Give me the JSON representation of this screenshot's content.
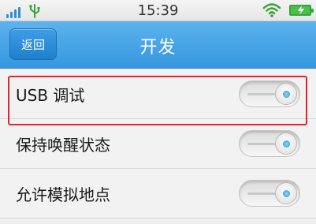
{
  "status_bar": {
    "time": "15:39",
    "icons": [
      "signal-icon",
      "usb-icon",
      "wifi-icon",
      "battery-charging-icon"
    ]
  },
  "header": {
    "back_label": "返回",
    "title": "开发"
  },
  "settings": [
    {
      "label": "USB 调试",
      "enabled": true,
      "highlighted": true
    },
    {
      "label": "保持唤醒状态",
      "enabled": true,
      "highlighted": false
    },
    {
      "label": "允许模拟地点",
      "enabled": true,
      "highlighted": false
    }
  ],
  "colors": {
    "header_blue": "#3597de",
    "highlight_red": "#e0242b",
    "toggle_dot_blue": "#1a95e6",
    "battery_green": "#4cc04c"
  }
}
